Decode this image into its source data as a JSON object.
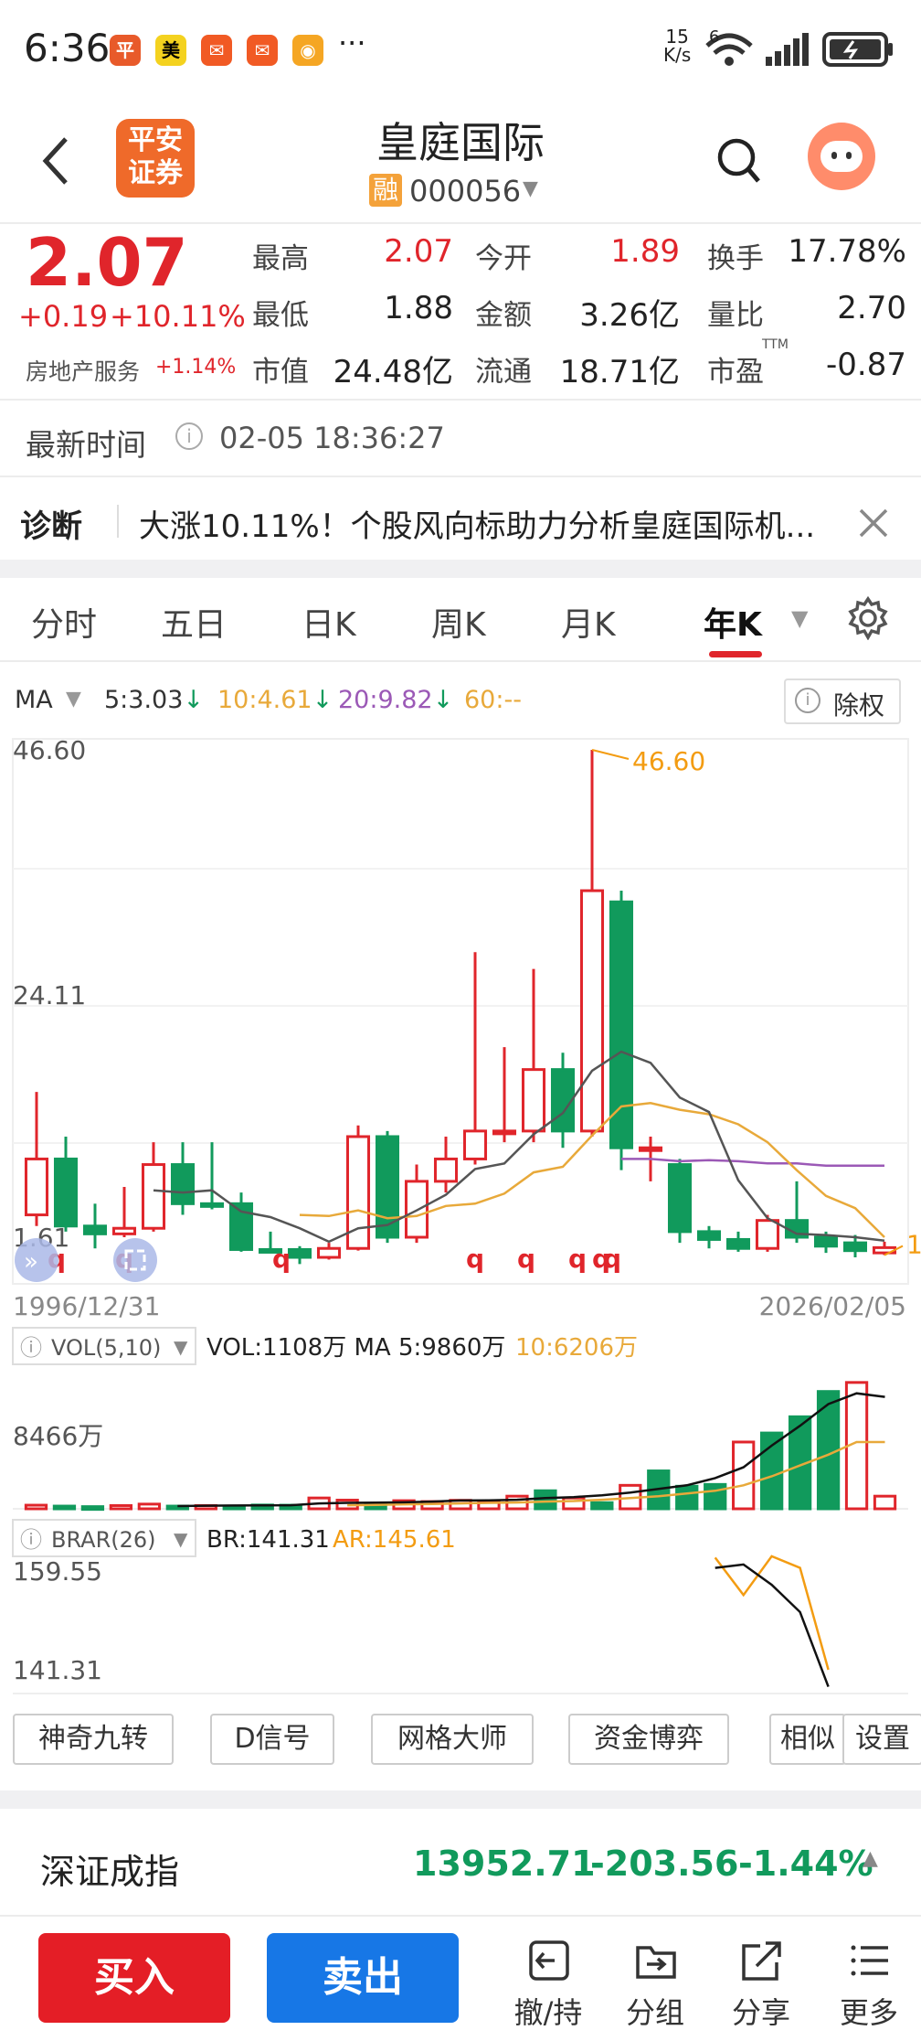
{
  "status_bar": {
    "time": "6:36",
    "net_speed_top": "15",
    "net_speed_unit": "K/s",
    "wifi_badge": "6",
    "ellipsis": "···",
    "app_icons": [
      "pingan-icon",
      "meituan-icon",
      "feishu-icon",
      "feishu-icon",
      "weibo-icon"
    ]
  },
  "header": {
    "logo_text_line1": "平安",
    "logo_text_line2": "证券",
    "stock_name": "皇庭国际",
    "margin_badge": "融",
    "stock_code": "000056"
  },
  "quote": {
    "price": "2.07",
    "change": "+0.19",
    "change_pct": "+10.11%",
    "sector": "房地产服务",
    "sector_change": "+1.14%",
    "rows": [
      [
        {
          "label": "最高",
          "value": "2.07",
          "color": "red"
        },
        {
          "label": "今开",
          "value": "1.89",
          "color": "red"
        },
        {
          "label": "换手",
          "value": "17.78%",
          "color": "black"
        }
      ],
      [
        {
          "label": "最低",
          "value": "1.88",
          "color": "black"
        },
        {
          "label": "金额",
          "value": "3.26亿",
          "color": "black"
        },
        {
          "label": "量比",
          "value": "2.70",
          "color": "black"
        }
      ],
      [
        {
          "label": "市值",
          "value": "24.48亿",
          "color": "black"
        },
        {
          "label": "流通",
          "value": "18.71亿",
          "color": "black"
        },
        {
          "label": "市盈",
          "value": "-0.87",
          "color": "black",
          "sup": "TTM"
        }
      ]
    ]
  },
  "update": {
    "label": "最新时间",
    "value": "02-05 18:36:27"
  },
  "diagnosis": {
    "label": "诊断",
    "text": "大涨10.11%！个股风向标助力分析皇庭国际机..."
  },
  "tabs": [
    "分时",
    "五日",
    "日K",
    "周K",
    "月K",
    "年K"
  ],
  "active_tab": "年K",
  "ma_legend": {
    "label": "MA",
    "ma5": "5:3.03",
    "ma10": "10:4.61",
    "ma20": "20:9.82",
    "ma60": "60:--",
    "exright": "除权"
  },
  "chart_data": {
    "type": "candlestick",
    "y_labels": [
      "46.60",
      "24.11",
      "1.61"
    ],
    "x_start": "1996/12/31",
    "x_end": "2026/02/05",
    "max_label": "46.60",
    "min_label": "1.61",
    "ylim": [
      1.61,
      46.6
    ],
    "candles": [
      {
        "o": 5.0,
        "c": 10.0,
        "h": 16.0,
        "l": 4.0,
        "up": true
      },
      {
        "o": 10.0,
        "c": 4.0,
        "h": 12.0,
        "l": 3.5,
        "up": false
      },
      {
        "o": 4.0,
        "c": 3.3,
        "h": 6.0,
        "l": 2.0,
        "up": false
      },
      {
        "o": 3.3,
        "c": 3.8,
        "h": 7.5,
        "l": 3.0,
        "up": true
      },
      {
        "o": 3.8,
        "c": 9.5,
        "h": 11.5,
        "l": 3.5,
        "up": true
      },
      {
        "o": 9.5,
        "c": 6.0,
        "h": 11.5,
        "l": 5.0,
        "up": false
      },
      {
        "o": 6.0,
        "c": 6.0,
        "h": 11.5,
        "l": 5.5,
        "up": false
      },
      {
        "o": 6.0,
        "c": 1.9,
        "h": 7.0,
        "l": 1.7,
        "up": false
      },
      {
        "o": 1.9,
        "c": 1.9,
        "h": 3.5,
        "l": 1.7,
        "up": false
      },
      {
        "o": 1.9,
        "c": 1.2,
        "h": 2.2,
        "l": 0.6,
        "up": false
      },
      {
        "o": 1.2,
        "c": 2.0,
        "h": 2.5,
        "l": 1.0,
        "up": true
      },
      {
        "o": 2.0,
        "c": 12.0,
        "h": 13.0,
        "l": 1.8,
        "up": true
      },
      {
        "o": 12.0,
        "c": 3.0,
        "h": 12.5,
        "l": 2.5,
        "up": false
      },
      {
        "o": 3.0,
        "c": 8.0,
        "h": 9.5,
        "l": 2.5,
        "up": true
      },
      {
        "o": 8.0,
        "c": 10.0,
        "h": 12.0,
        "l": 7.0,
        "up": true
      },
      {
        "o": 10.0,
        "c": 12.5,
        "h": 28.5,
        "l": 9.5,
        "up": true
      },
      {
        "o": 12.5,
        "c": 12.5,
        "h": 20.0,
        "l": 11.5,
        "up": true
      },
      {
        "o": 12.5,
        "c": 18.0,
        "h": 27.0,
        "l": 11.5,
        "up": true
      },
      {
        "o": 18.0,
        "c": 12.5,
        "h": 19.5,
        "l": 11.0,
        "up": false
      },
      {
        "o": 12.5,
        "c": 34.0,
        "h": 46.6,
        "l": 12.0,
        "up": true
      },
      {
        "o": 33.0,
        "c": 11.0,
        "h": 34.0,
        "l": 9.0,
        "up": false
      },
      {
        "o": 11.0,
        "c": 11.0,
        "h": 12.0,
        "l": 8.0,
        "up": true
      },
      {
        "o": 9.5,
        "c": 3.5,
        "h": 10.0,
        "l": 2.5,
        "up": false
      },
      {
        "o": 3.5,
        "c": 2.8,
        "h": 4.0,
        "l": 2.0,
        "up": false
      },
      {
        "o": 2.8,
        "c": 2.0,
        "h": 3.5,
        "l": 1.7,
        "up": false
      },
      {
        "o": 2.0,
        "c": 4.5,
        "h": 5.0,
        "l": 1.7,
        "up": true
      },
      {
        "o": 4.5,
        "c": 3.0,
        "h": 8.0,
        "l": 2.5,
        "up": false
      },
      {
        "o": 3.0,
        "c": 2.2,
        "h": 3.5,
        "l": 1.6,
        "up": false
      },
      {
        "o": 2.5,
        "c": 1.8,
        "h": 3.2,
        "l": 1.2,
        "up": false
      },
      {
        "o": 1.6,
        "c": 2.07,
        "h": 2.6,
        "l": 1.4,
        "up": true
      }
    ],
    "ma5": [
      null,
      null,
      null,
      null,
      7.2,
      7.0,
      7.2,
      5.3,
      4.8,
      3.8,
      2.6,
      3.8,
      4.1,
      5.4,
      6.8,
      9.1,
      9.6,
      12.2,
      14.1,
      17.9,
      19.6,
      18.6,
      15.5,
      14.2,
      8.1,
      4.7,
      3.3,
      3.2,
      3.0,
      2.7
    ],
    "ma10": [
      null,
      null,
      null,
      null,
      null,
      null,
      null,
      null,
      null,
      5.0,
      4.9,
      5.4,
      4.7,
      4.9,
      5.8,
      6.0,
      6.9,
      8.8,
      9.3,
      12.1,
      14.7,
      15.0,
      14.4,
      14.0,
      13.1,
      11.5,
      9.0,
      6.7,
      5.6,
      3.0
    ],
    "ma20": [
      null,
      null,
      null,
      null,
      null,
      null,
      null,
      null,
      null,
      null,
      null,
      null,
      null,
      null,
      null,
      null,
      null,
      null,
      null,
      null,
      10.0,
      10.0,
      9.8,
      9.9,
      9.8,
      9.6,
      9.6,
      9.4,
      9.4,
      9.4
    ],
    "markers": [
      "q",
      "q",
      "q",
      "q",
      "q",
      "q",
      "q",
      "q"
    ],
    "vol_legend": {
      "label": "VOL(5,10)",
      "vol": "VOL:1108万",
      "ma5": "MA 5:9860万",
      "ma10": "10:6206万"
    },
    "vol_label": "8466万",
    "volumes": [
      200,
      150,
      120,
      180,
      260,
      150,
      180,
      150,
      210,
      200,
      600,
      480,
      300,
      450,
      400,
      470,
      420,
      700,
      1000,
      600,
      340,
      1300,
      2100,
      1250,
      1350,
      3700,
      4200,
      5100,
      6500,
      7000,
      700
    ],
    "vol_ma5": [
      null,
      null,
      null,
      null,
      null,
      150,
      170,
      180,
      190,
      200,
      300,
      330,
      340,
      360,
      400,
      460,
      470,
      500,
      600,
      650,
      750,
      900,
      1100,
      1300,
      1700,
      2300,
      3500,
      4600,
      5800,
      6400,
      6200
    ],
    "vol_ma10": [
      null,
      null,
      null,
      null,
      null,
      null,
      null,
      null,
      null,
      null,
      null,
      200,
      220,
      250,
      270,
      300,
      330,
      350,
      400,
      430,
      500,
      600,
      700,
      850,
      1000,
      1300,
      1800,
      2400,
      3000,
      3700,
      3700
    ],
    "vol_up": [
      true,
      false,
      false,
      true,
      true,
      false,
      true,
      false,
      false,
      false,
      true,
      true,
      false,
      true,
      true,
      true,
      true,
      true,
      false,
      true,
      false,
      true,
      false,
      false,
      false,
      true,
      false,
      false,
      false,
      true,
      true
    ],
    "brar_legend": {
      "label": "BRAR(26)",
      "br": "BR:141.31",
      "ar": "AR:145.61"
    },
    "brar_labels": [
      "159.55",
      "141.31"
    ],
    "br_values": [
      158.5,
      159.0,
      156.0,
      152.0,
      141.0
    ],
    "ar_values": [
      160.0,
      154.5,
      160.2,
      158.5,
      143.5
    ],
    "br_ar_start_index": 24
  },
  "tool_buttons": [
    "神奇九转",
    "D信号",
    "网格大师",
    "资金博弈",
    "相似",
    "设置"
  ],
  "index_bar": {
    "name": "深证成指",
    "value": "13952.71",
    "change": "-203.56",
    "pct": "-1.44%"
  },
  "bottom": {
    "buy": "买入",
    "sell": "卖出",
    "actions": [
      "撤/持",
      "分组",
      "分享",
      "更多"
    ]
  },
  "colors": {
    "up": "#e0252b",
    "down": "#119a5c",
    "ma5": "#555555",
    "ma10": "#e8a93a",
    "ma20": "#9b59b6",
    "ma60": "#e8a93a",
    "accent": "#f39c12",
    "buy": "#e41e26",
    "sell": "#1777e6"
  }
}
